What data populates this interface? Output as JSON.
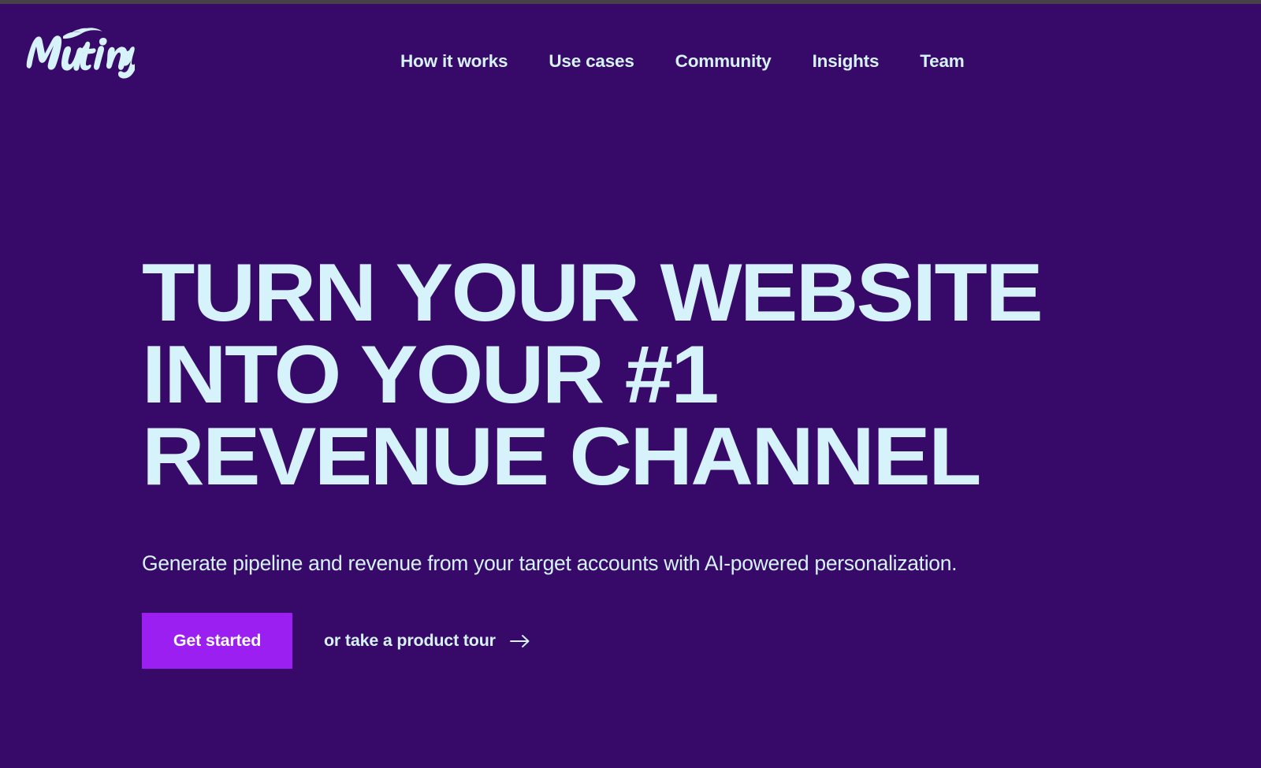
{
  "theme": {
    "background": "#370A69",
    "text_light": "#D6F2FA",
    "accent_button": "#9B1FF0",
    "button_text": "#FFFFFF",
    "chrome_strip": "#474248"
  },
  "header": {
    "logo_text": "Mutiny",
    "logo_icon": "mutiny-wordmark",
    "nav": [
      {
        "label": "How it works"
      },
      {
        "label": "Use cases"
      },
      {
        "label": "Community"
      },
      {
        "label": "Insights"
      },
      {
        "label": "Team"
      }
    ]
  },
  "hero": {
    "headline_lines": [
      "TURN YOUR WEBSITE",
      "INTO YOUR #1",
      "REVENUE CHANNEL"
    ],
    "subheadline": "Generate pipeline and revenue from your target accounts with AI-powered personalization.",
    "primary_cta": "Get started",
    "secondary_cta": "or take a product tour",
    "secondary_cta_icon": "arrow-right-icon"
  }
}
